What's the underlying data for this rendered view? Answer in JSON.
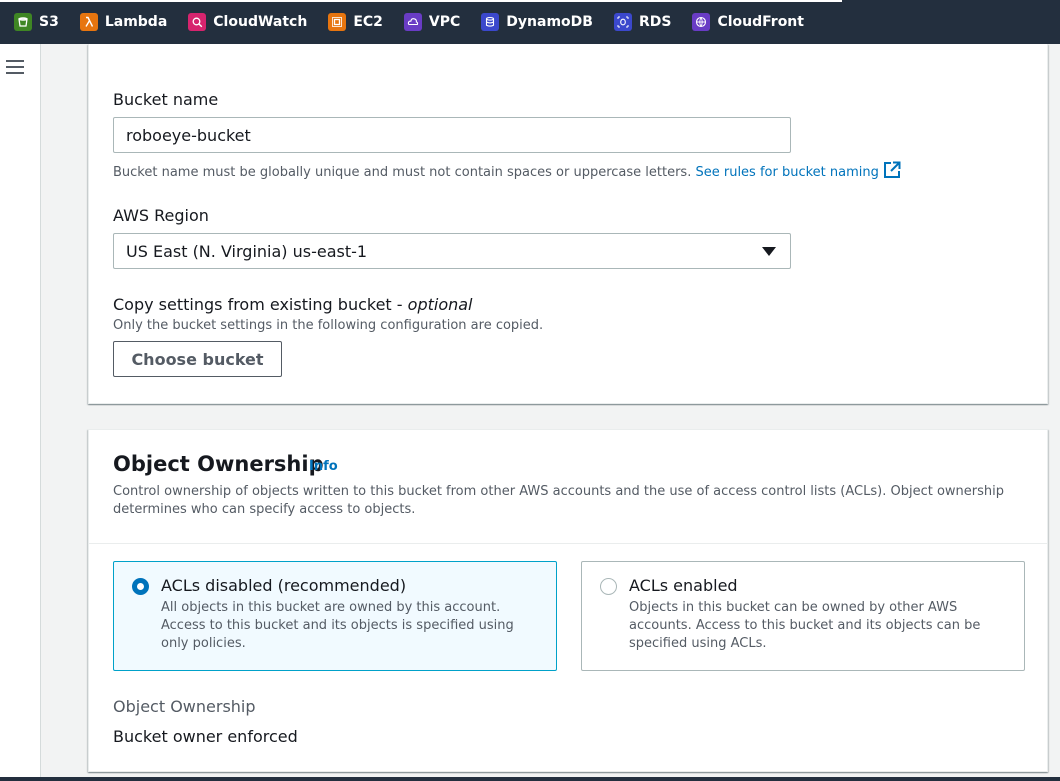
{
  "services_bar": {
    "items": [
      {
        "label": "S3",
        "icon": "s3-icon",
        "color": "#3f8624"
      },
      {
        "label": "Lambda",
        "icon": "lambda-icon",
        "color": "#e7750f"
      },
      {
        "label": "CloudWatch",
        "icon": "cloudwatch-icon",
        "color": "#d6246e"
      },
      {
        "label": "EC2",
        "icon": "ec2-icon",
        "color": "#e7750f"
      },
      {
        "label": "VPC",
        "icon": "vpc-icon",
        "color": "#693cc5"
      },
      {
        "label": "DynamoDB",
        "icon": "dynamodb-icon",
        "color": "#3b48cc"
      },
      {
        "label": "RDS",
        "icon": "rds-icon",
        "color": "#3b48cc"
      },
      {
        "label": "CloudFront",
        "icon": "cloudfront-icon",
        "color": "#693cc5"
      }
    ]
  },
  "general_configuration": {
    "bucket_name": {
      "label": "Bucket name",
      "value": "roboeye-bucket",
      "hint": "Bucket name must be globally unique and must not contain spaces or uppercase letters.",
      "hint_link": "See rules for bucket naming"
    },
    "region": {
      "label": "AWS Region",
      "value": "US East (N. Virginia) us-east-1"
    },
    "copy_settings": {
      "label": "Copy settings from existing bucket - ",
      "label_optional": "optional",
      "hint": "Only the bucket settings in the following configuration are copied.",
      "button": "Choose bucket"
    }
  },
  "object_ownership": {
    "title": "Object Ownership",
    "info": "Info",
    "description": "Control ownership of objects written to this bucket from other AWS accounts and the use of access control lists (ACLs). Object ownership determines who can specify access to objects.",
    "options": [
      {
        "title": "ACLs disabled (recommended)",
        "description": "All objects in this bucket are owned by this account. Access to this bucket and its objects is specified using only policies.",
        "selected": true
      },
      {
        "title": "ACLs enabled",
        "description": "Objects in this bucket can be owned by other AWS accounts. Access to this bucket and its objects can be specified using ACLs.",
        "selected": false
      }
    ],
    "summary_label": "Object Ownership",
    "summary_value": "Bucket owner enforced"
  },
  "colors": {
    "nav_bg": "#232f3e",
    "link": "#0073bb",
    "selected_border": "#00a1c9",
    "selected_bg": "#f1faff"
  }
}
